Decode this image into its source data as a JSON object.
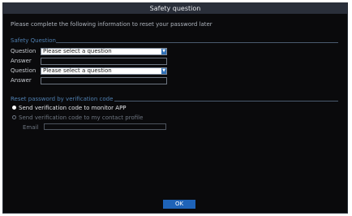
{
  "dialog": {
    "title": "Safety question",
    "intro": "Please complete the following information to reset your password later"
  },
  "safety_section": {
    "title": "Safety Question",
    "question_label": "Question",
    "answer_label": "Answer",
    "question_1": {
      "value": "Please select a question",
      "answer": ""
    },
    "question_2": {
      "value": "Please select a question",
      "answer": ""
    }
  },
  "reset_section": {
    "title": "Reset password by verification code",
    "options": [
      {
        "label": "Send verification code to monitor APP",
        "selected": true
      },
      {
        "label": "Send verification code to my contact profile",
        "selected": false
      }
    ],
    "email_label": "Email",
    "email_value": ""
  },
  "footer": {
    "ok_label": "OK"
  },
  "colors": {
    "dialog_bg": "#0a0a0c",
    "titlebar_bg": "#2a2f3a",
    "section_title": "#4f7fb0",
    "select_arrow": "#2f6fb6",
    "ok_button": "#1e63b8"
  },
  "icons": {
    "dropdown": "chevron-down-icon"
  }
}
